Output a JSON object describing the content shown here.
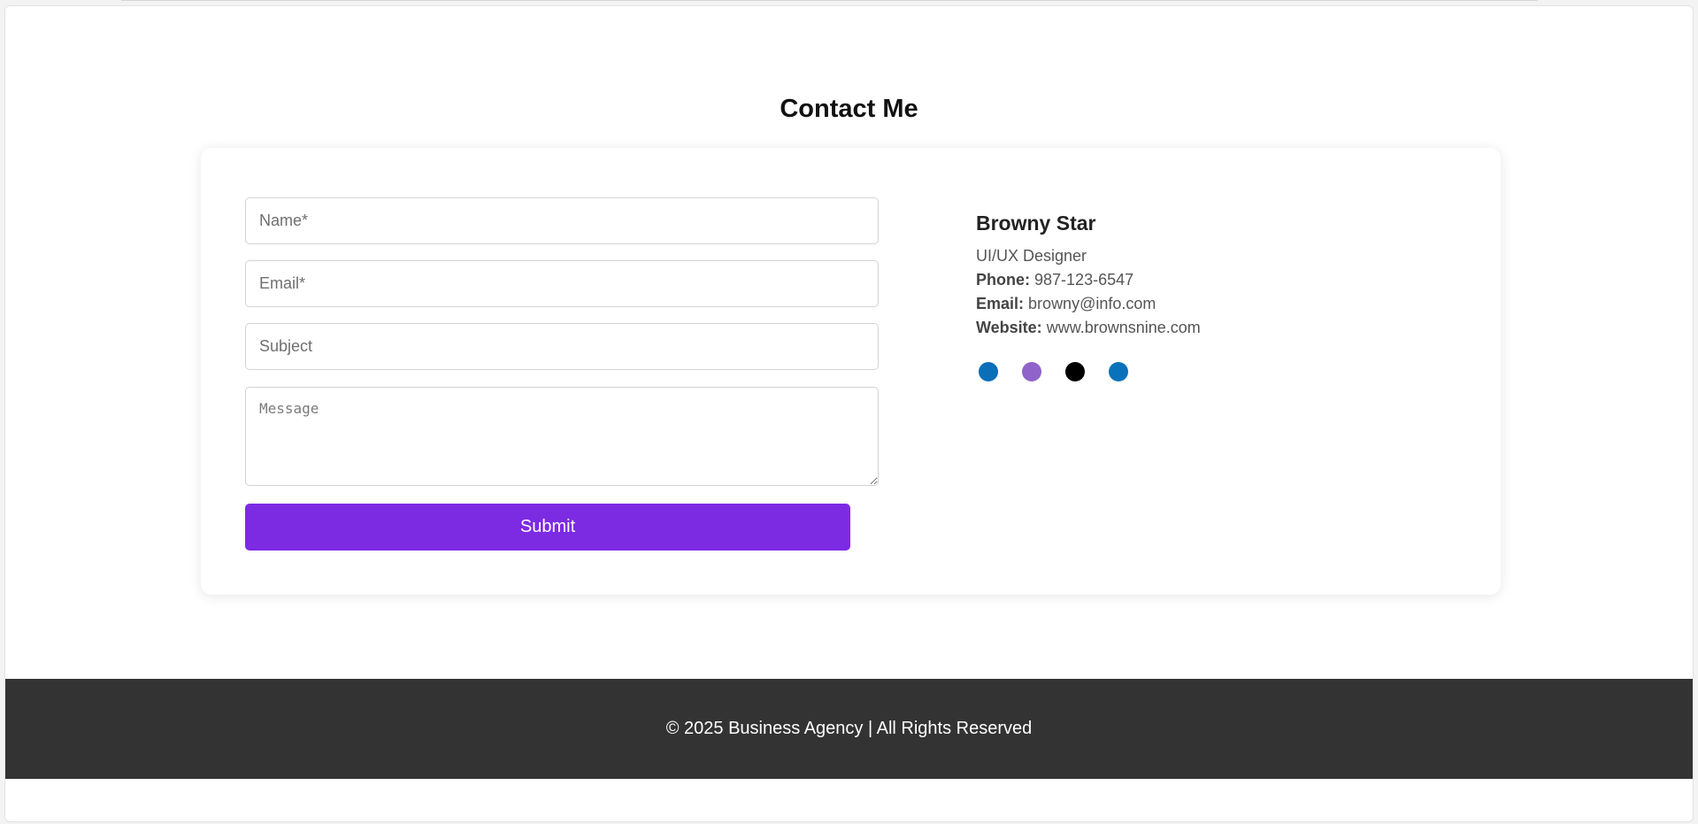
{
  "contact": {
    "title": "Contact Me",
    "form": {
      "name_placeholder": "Name*",
      "email_placeholder": "Email*",
      "subject_placeholder": "Subject",
      "message_placeholder": "Message",
      "submit_label": "Submit"
    },
    "profile": {
      "name": "Browny Star",
      "role": "UI/UX Designer",
      "phone_label": "Phone:",
      "phone": "987-123-6547",
      "email_label": "Email:",
      "email": "browny@info.com",
      "website_label": "Website:",
      "website": "www.brownsnine.com"
    },
    "socials": [
      {
        "icon": "facebook-icon",
        "color": "#0a6eb8"
      },
      {
        "icon": "dribbble-icon",
        "color": "#8f63c9"
      },
      {
        "icon": "github-icon",
        "color": "#000000"
      },
      {
        "icon": "linkedin-icon",
        "color": "#0a72ba"
      }
    ]
  },
  "footer": {
    "text": "© 2025 Business Agency | All Rights Reserved"
  },
  "colors": {
    "accent": "#7d2ae3",
    "footer_bg": "#333333"
  }
}
